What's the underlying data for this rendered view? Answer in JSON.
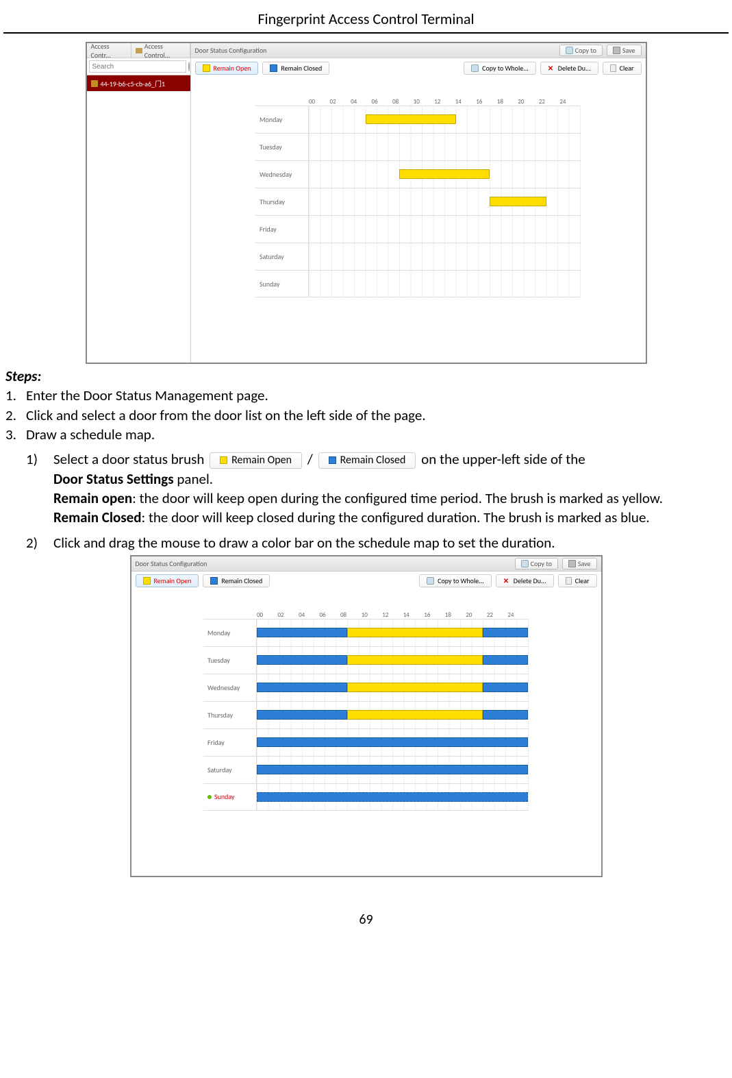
{
  "doc_title": "Fingerprint Access Control Terminal",
  "page_number": "69",
  "steps_header": "Steps:",
  "steps": [
    {
      "num": "1.",
      "text": "Enter the Door Status Management page."
    },
    {
      "num": "2.",
      "text": "Click and select a door from the door list on the left side of the page."
    },
    {
      "num": "3.",
      "text": "Draw a schedule map."
    }
  ],
  "substeps": {
    "s1_num": "1)",
    "s1_a": "Select a door status brush",
    "s1_b": "on the upper-left side of the",
    "s1_panel_bold": "Door Status Settings",
    "s1_panel_suffix": " panel.",
    "remain_open_bold": "Remain open",
    "remain_open_desc": ": the door will keep open during the configured time period. The brush is marked as yellow.",
    "remain_closed_bold": "Remain Closed",
    "remain_closed_desc": ": the door will keep closed during the configured duration. The brush is marked as blue.",
    "s2_num": "2)",
    "s2_text": "Click and drag the mouse to draw a color bar on the schedule map to set the duration."
  },
  "inline_btn": {
    "open": "Remain Open",
    "closed": "Remain Closed",
    "slash": " / "
  },
  "ss_common": {
    "title": "Door Status Configuration",
    "copy_to": "Copy to",
    "save": "Save",
    "remain_open": "Remain Open",
    "remain_closed": "Remain Closed",
    "copy_whole": "Copy to Whole...",
    "delete_du": "Delete Du...",
    "clear": "Clear",
    "hours": [
      "00",
      "02",
      "04",
      "06",
      "08",
      "10",
      "12",
      "14",
      "16",
      "18",
      "20",
      "22",
      "24"
    ],
    "days": [
      "Monday",
      "Tuesday",
      "Wednesday",
      "Thursday",
      "Friday",
      "Saturday",
      "Sunday"
    ]
  },
  "ss1": {
    "tab1": "Access Contr...",
    "tab2": "Access Control...",
    "search_placeholder": "Search",
    "door_item": "44-19-b6-c5-cb-a6_门1",
    "bars": {
      "Monday": {
        "yellow": [
          {
            "start": 5,
            "end": 13
          }
        ]
      },
      "Wednesday": {
        "yellow": [
          {
            "start": 8,
            "end": 16
          }
        ]
      },
      "Thursday": {
        "yellow": [
          {
            "start": 16,
            "end": 21
          }
        ]
      }
    }
  },
  "ss2": {
    "selected_day": "Sunday",
    "bars": {
      "Monday": {
        "blue": [
          {
            "start": 0,
            "end": 8
          },
          {
            "start": 20,
            "end": 24
          }
        ],
        "yellow": [
          {
            "start": 8,
            "end": 20
          }
        ]
      },
      "Tuesday": {
        "blue": [
          {
            "start": 0,
            "end": 8
          },
          {
            "start": 20,
            "end": 24
          }
        ],
        "yellow": [
          {
            "start": 8,
            "end": 20
          }
        ]
      },
      "Wednesday": {
        "blue": [
          {
            "start": 0,
            "end": 8
          },
          {
            "start": 20,
            "end": 24
          }
        ],
        "yellow": [
          {
            "start": 8,
            "end": 20
          }
        ]
      },
      "Thursday": {
        "blue": [
          {
            "start": 0,
            "end": 8
          },
          {
            "start": 20,
            "end": 24
          }
        ],
        "yellow": [
          {
            "start": 8,
            "end": 20
          }
        ]
      },
      "Friday": {
        "blue": [
          {
            "start": 0,
            "end": 24
          }
        ]
      },
      "Saturday": {
        "blue": [
          {
            "start": 0,
            "end": 24
          }
        ]
      },
      "Sunday": {
        "blue_dashed": [
          {
            "start": 0,
            "end": 24
          }
        ]
      }
    }
  }
}
